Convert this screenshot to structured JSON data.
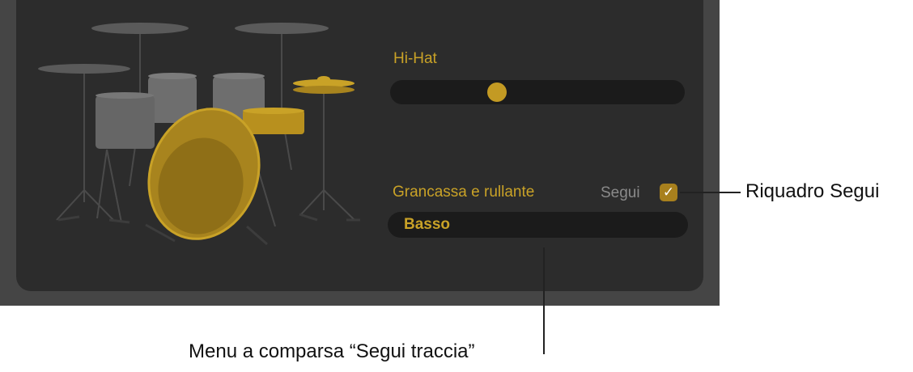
{
  "hihat": {
    "title": "Hi-Hat",
    "slider_value": 0.35
  },
  "kick_snare": {
    "title": "Grancassa e rullante",
    "follow_label": "Segui",
    "follow_checked": true,
    "follow_check_glyph": "✓",
    "popup_value": "Basso"
  },
  "callouts": {
    "follow_checkbox": "Riquadro Segui",
    "follow_track_menu": "Menu a comparsa “Segui traccia”"
  },
  "colors": {
    "accent_gold": "#c9a227",
    "panel_bg": "#2c2c2c",
    "frame_bg": "#454545",
    "inactive_gray": "#8a8a8a"
  }
}
